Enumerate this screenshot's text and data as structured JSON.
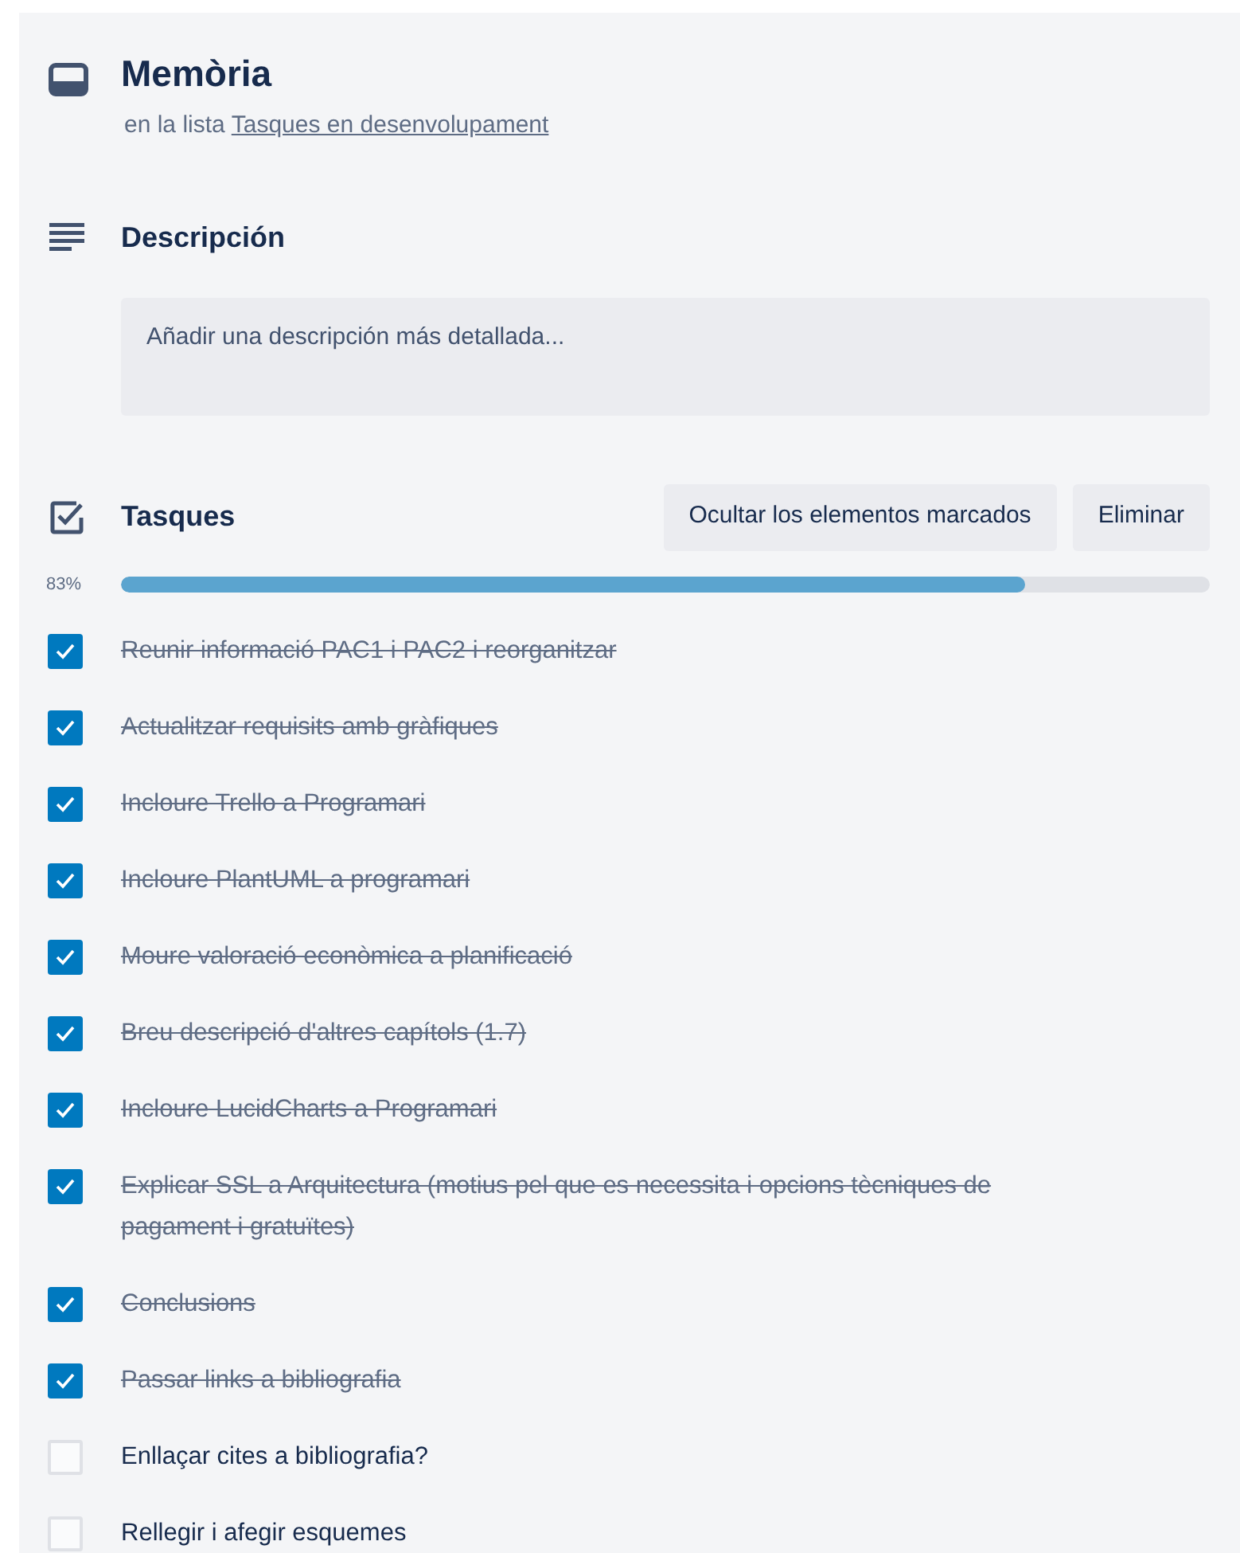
{
  "card": {
    "title": "Memòria",
    "list_prefix": "en la lista",
    "list_link": "Tasques en desenvolupament"
  },
  "description": {
    "heading": "Descripción",
    "placeholder": "Añadir una descripción más detallada..."
  },
  "checklist": {
    "title": "Tasques",
    "buttons": [
      "Ocultar los elementos marcados",
      "Eliminar"
    ],
    "percent": "83%",
    "level": 0.83,
    "items": [
      {
        "text": "Reunir informació PAC1 i PAC2 i reorganitzar",
        "checked": true
      },
      {
        "text": "Actualitzar requisits amb gràfiques",
        "checked": true
      },
      {
        "text": "Incloure Trello a Programari",
        "checked": true
      },
      {
        "text": "Incloure PlantUML a programari",
        "checked": true
      },
      {
        "text": "Moure valoració econòmica a planificació",
        "checked": true
      },
      {
        "text": "Breu descripció d'altres capítols (1.7)",
        "checked": true
      },
      {
        "text": "Incloure LucidCharts a Programari",
        "checked": true
      },
      {
        "text": "Explicar SSL a Arquitectura (motius pel que es necessita i opcions tècniques de pagament i gratuïtes)",
        "checked": true
      },
      {
        "text": "Conclusions",
        "checked": true
      },
      {
        "text": "Passar links a bibliografia",
        "checked": true
      },
      {
        "text": "Enllaçar cites a bibliografia?",
        "checked": false
      },
      {
        "text": "Rellegir i afegir esquemes",
        "checked": false
      }
    ]
  }
}
